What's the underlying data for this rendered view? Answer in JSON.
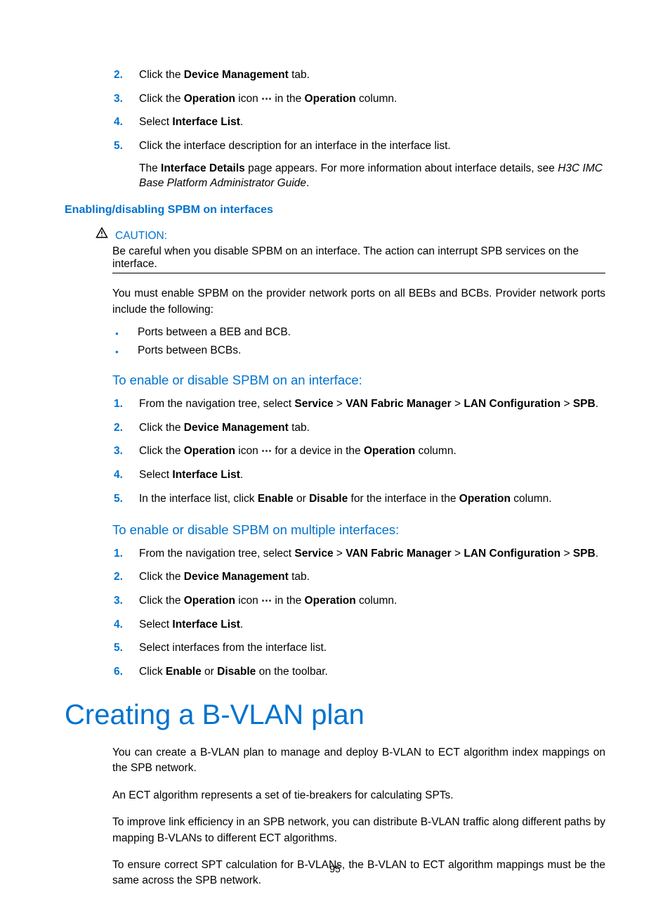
{
  "steps_a": [
    {
      "n": "2.",
      "parts": [
        [
          "",
          "Click the "
        ],
        [
          "b",
          "Device Management"
        ],
        [
          "",
          " tab."
        ]
      ]
    },
    {
      "n": "3.",
      "parts": [
        [
          "",
          "Click the "
        ],
        [
          "b",
          "Operation"
        ],
        [
          "",
          " icon "
        ],
        [
          "icon",
          "⋯"
        ],
        [
          "",
          " in the "
        ],
        [
          "b",
          "Operation"
        ],
        [
          "",
          " column."
        ]
      ]
    },
    {
      "n": "4.",
      "parts": [
        [
          "",
          "Select "
        ],
        [
          "b",
          "Interface List"
        ],
        [
          "",
          "."
        ]
      ]
    },
    {
      "n": "5.",
      "parts": [
        [
          "",
          "Click the interface description for an interface in the interface list."
        ]
      ],
      "sub": [
        [
          "",
          "The "
        ],
        [
          "b",
          "Interface Details"
        ],
        [
          "",
          " page appears. For more information about interface details, see "
        ],
        [
          "i",
          "H3C IMC Base Platform Administrator Guide"
        ],
        [
          "",
          "."
        ]
      ]
    }
  ],
  "h4_1": "Enabling/disabling SPBM on interfaces",
  "caution_label": "CAUTION:",
  "caution_text": "Be careful when you disable SPBM on an interface. The action can interrupt SPB services on the interface.",
  "para_1": "You must enable SPBM on the provider network ports on all BEBs and BCBs. Provider network ports include the following:",
  "bullets": [
    "Ports between a BEB and BCB.",
    "Ports between BCBs."
  ],
  "h5_1": "To enable or disable SPBM on an interface:",
  "steps_b": [
    {
      "n": "1.",
      "parts": [
        [
          "",
          "From the navigation tree, select "
        ],
        [
          "b",
          "Service"
        ],
        [
          "",
          " > "
        ],
        [
          "b",
          "VAN Fabric Manager"
        ],
        [
          "",
          " > "
        ],
        [
          "b",
          "LAN Configuration"
        ],
        [
          "",
          " > "
        ],
        [
          "b",
          "SPB"
        ],
        [
          "",
          "."
        ]
      ]
    },
    {
      "n": "2.",
      "parts": [
        [
          "",
          "Click the "
        ],
        [
          "b",
          "Device Management"
        ],
        [
          "",
          " tab."
        ]
      ]
    },
    {
      "n": "3.",
      "parts": [
        [
          "",
          "Click the "
        ],
        [
          "b",
          "Operation"
        ],
        [
          "",
          " icon "
        ],
        [
          "icon",
          "⋯"
        ],
        [
          "",
          " for a device in the "
        ],
        [
          "b",
          "Operation"
        ],
        [
          "",
          " column."
        ]
      ]
    },
    {
      "n": "4.",
      "parts": [
        [
          "",
          "Select "
        ],
        [
          "b",
          "Interface List"
        ],
        [
          "",
          "."
        ]
      ]
    },
    {
      "n": "5.",
      "parts": [
        [
          "",
          "In the interface list, click "
        ],
        [
          "b",
          "Enable"
        ],
        [
          "",
          " or "
        ],
        [
          "b",
          "Disable"
        ],
        [
          "",
          " for the interface in the "
        ],
        [
          "b",
          "Operation"
        ],
        [
          "",
          " column."
        ]
      ]
    }
  ],
  "h5_2": "To enable or disable SPBM on multiple interfaces:",
  "steps_c": [
    {
      "n": "1.",
      "parts": [
        [
          "",
          "From the navigation tree, select "
        ],
        [
          "b",
          "Service"
        ],
        [
          "",
          " > "
        ],
        [
          "b",
          "VAN Fabric Manager"
        ],
        [
          "",
          " > "
        ],
        [
          "b",
          "LAN Configuration"
        ],
        [
          "",
          " > "
        ],
        [
          "b",
          "SPB"
        ],
        [
          "",
          "."
        ]
      ]
    },
    {
      "n": "2.",
      "parts": [
        [
          "",
          "Click the "
        ],
        [
          "b",
          "Device Management"
        ],
        [
          "",
          " tab."
        ]
      ]
    },
    {
      "n": "3.",
      "parts": [
        [
          "",
          "Click the "
        ],
        [
          "b",
          "Operation"
        ],
        [
          "",
          " icon "
        ],
        [
          "icon",
          "⋯"
        ],
        [
          "",
          " in the "
        ],
        [
          "b",
          "Operation"
        ],
        [
          "",
          " column."
        ]
      ]
    },
    {
      "n": "4.",
      "parts": [
        [
          "",
          "Select "
        ],
        [
          "b",
          "Interface List"
        ],
        [
          "",
          "."
        ]
      ]
    },
    {
      "n": "5.",
      "parts": [
        [
          "",
          "Select interfaces from the interface list."
        ]
      ]
    },
    {
      "n": "6.",
      "parts": [
        [
          "",
          "Click "
        ],
        [
          "b",
          "Enable"
        ],
        [
          "",
          " or "
        ],
        [
          "b",
          "Disable"
        ],
        [
          "",
          " on the toolbar."
        ]
      ]
    }
  ],
  "h1": "Creating a B-VLAN plan",
  "body": [
    "You can create a B-VLAN plan to manage and deploy B-VLAN to ECT algorithm index mappings on the SPB network.",
    "An ECT algorithm represents a set of tie-breakers for calculating SPTs.",
    "To improve link efficiency in an SPB network, you can distribute B-VLAN traffic along different paths by mapping B-VLANs to different ECT algorithms.",
    "To ensure correct SPT calculation for B-VLANs, the B-VLAN to ECT algorithm mappings must be the same across the SPB network."
  ],
  "page_number": "95"
}
